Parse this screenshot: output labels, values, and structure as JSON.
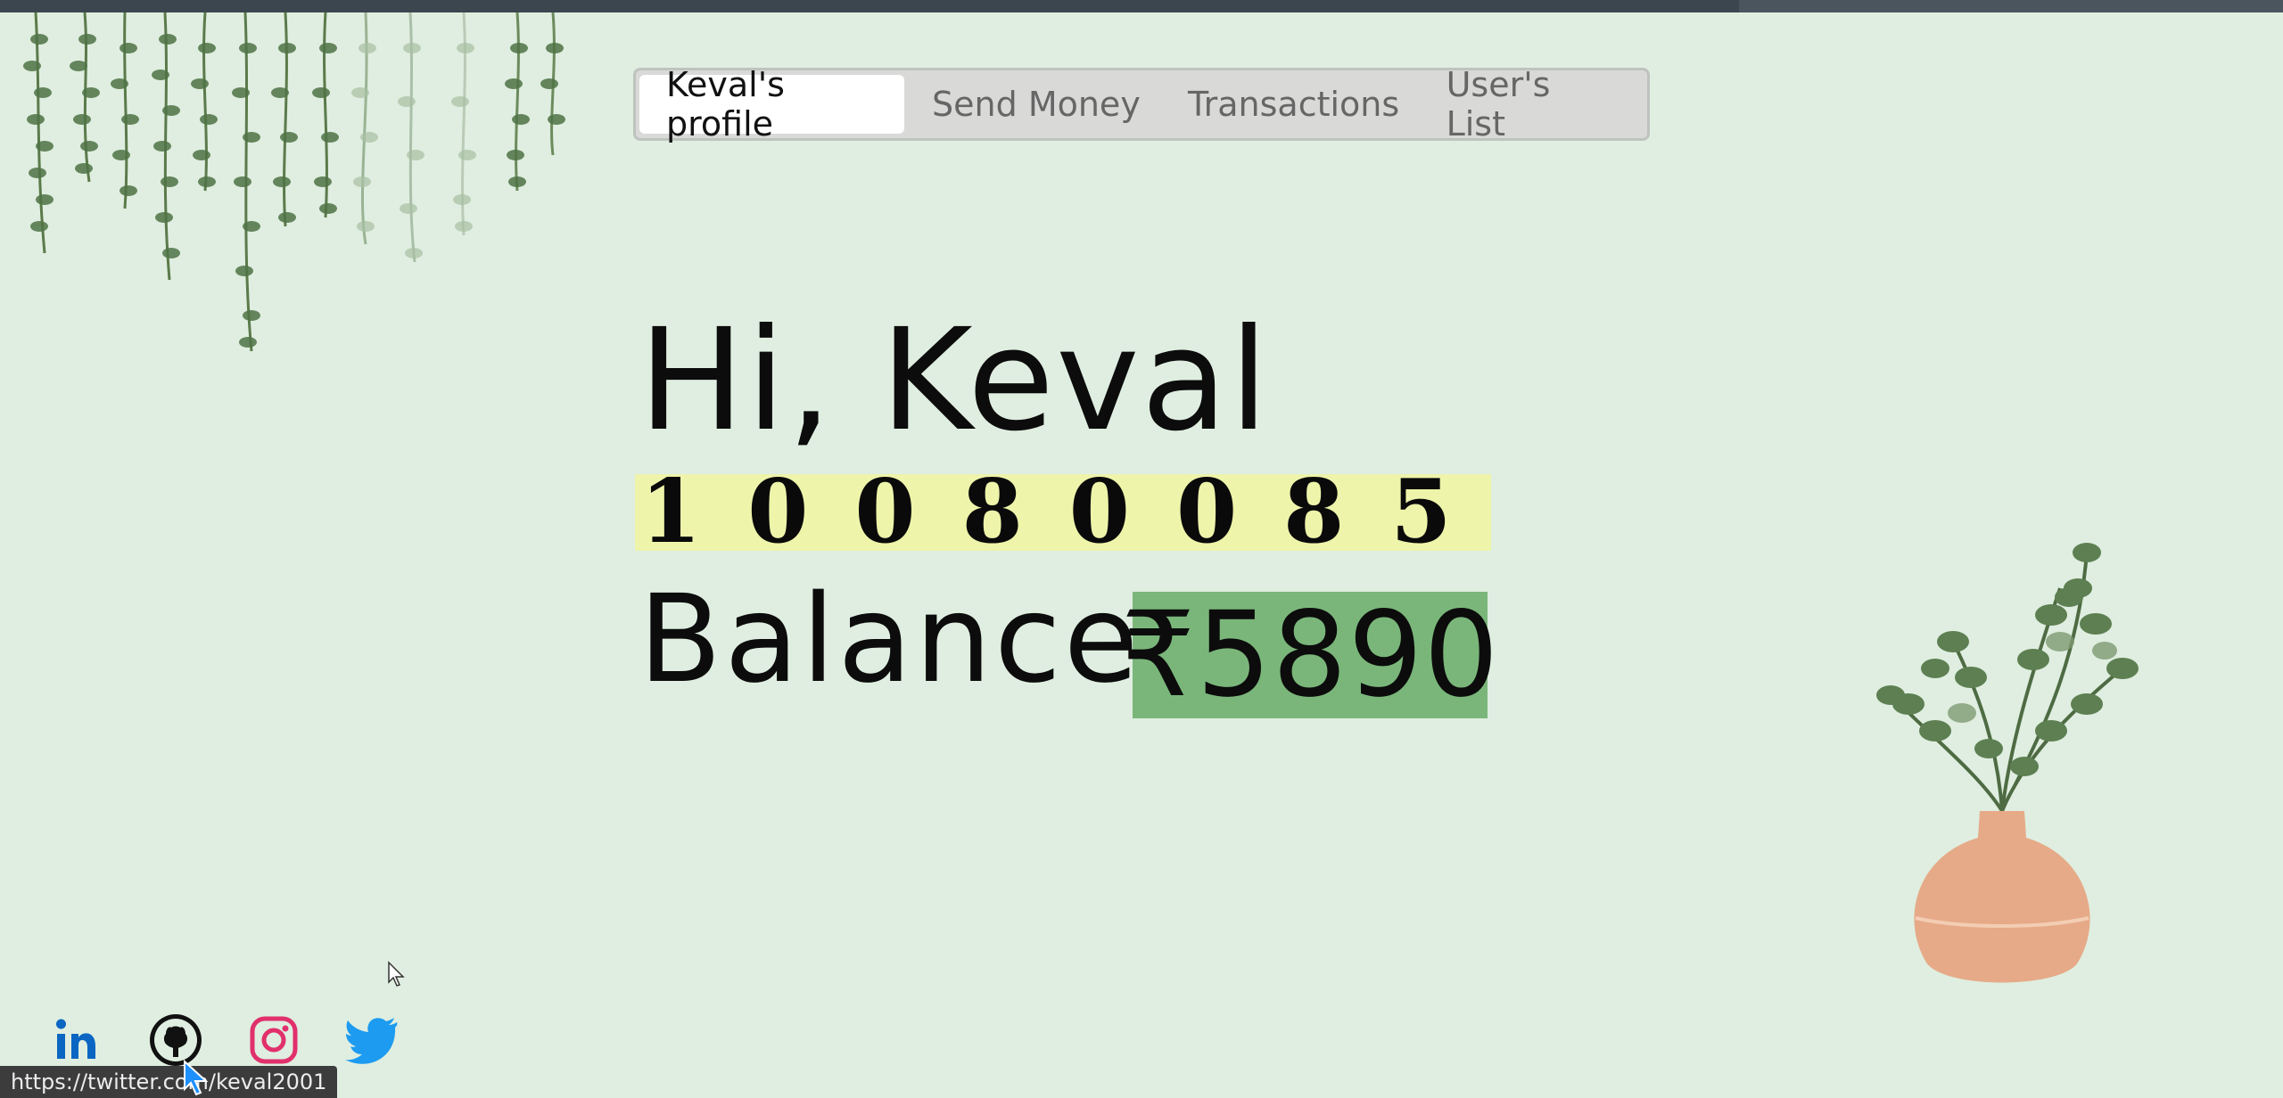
{
  "nav": {
    "tabs": [
      {
        "label": "Keval's profile",
        "active": true
      },
      {
        "label": "Send Money",
        "active": false
      },
      {
        "label": "Transactions",
        "active": false
      },
      {
        "label": "User's List",
        "active": false
      }
    ]
  },
  "profile": {
    "greeting": "Hi, Keval",
    "account_number": "10080085",
    "balance_label": "Balance",
    "balance_value": "₹5890"
  },
  "social": {
    "icons": [
      "linkedin-icon",
      "github-icon",
      "instagram-icon",
      "twitter-icon"
    ]
  },
  "status_bar": {
    "url": "https://twitter.com/keval2001"
  },
  "colors": {
    "background": "#dfeee0",
    "account_highlight": "#eef4aa",
    "balance_highlight": "#7ab67a",
    "linkedin": "#0a66c2",
    "instagram": "#e1306c",
    "twitter": "#1d9bf0"
  }
}
